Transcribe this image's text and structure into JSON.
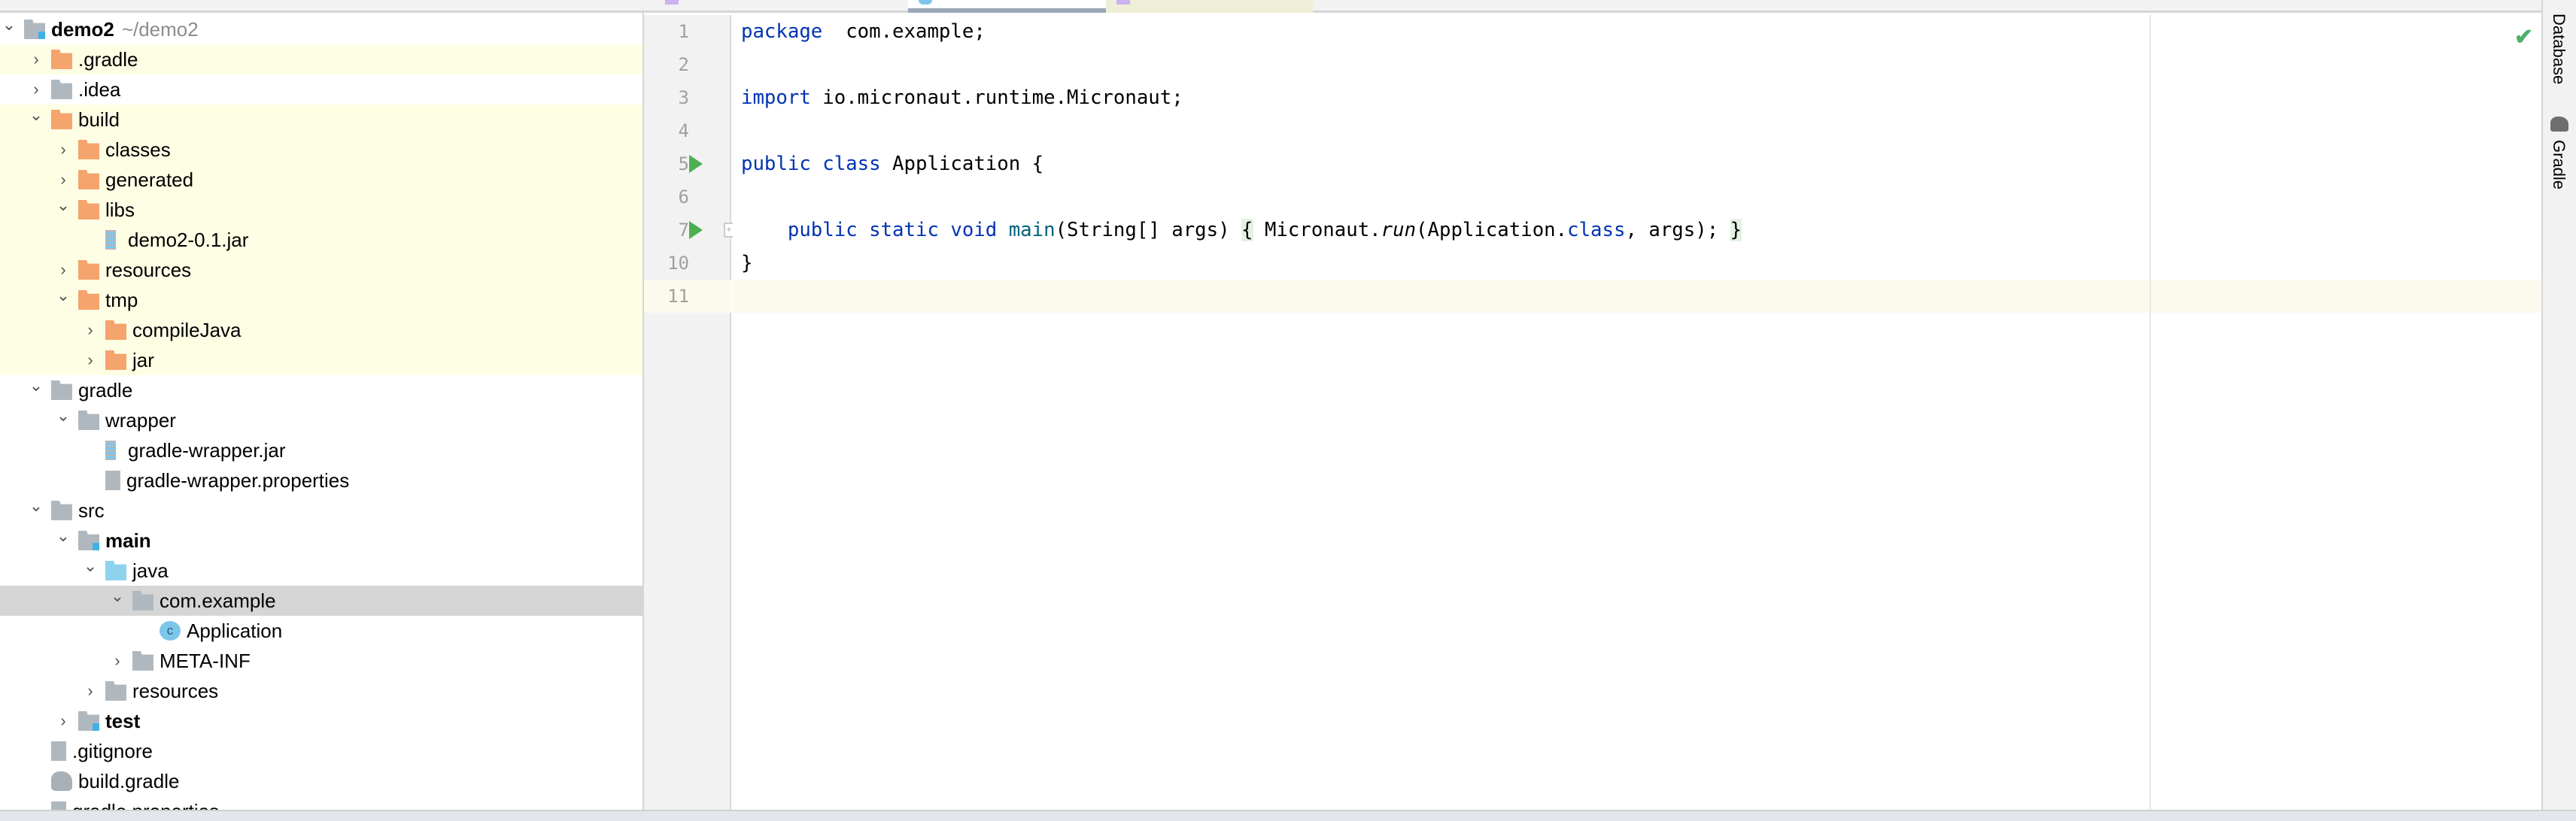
{
  "tree": {
    "rows": [
      {
        "label": "demo2",
        "hint": "~/demo2",
        "level": 0,
        "chev": "down",
        "icon": "module-folder-icon",
        "bold": true
      },
      {
        "label": ".gradle",
        "level": 1,
        "chev": "right",
        "icon": "excluded-folder-icon",
        "yellow": true
      },
      {
        "label": ".idea",
        "level": 1,
        "chev": "right",
        "icon": "folder-icon"
      },
      {
        "label": "build",
        "level": 1,
        "chev": "down",
        "icon": "excluded-folder-icon",
        "yellow": true
      },
      {
        "label": "classes",
        "level": 2,
        "chev": "right",
        "icon": "excluded-folder-icon",
        "yellow": true
      },
      {
        "label": "generated",
        "level": 2,
        "chev": "right",
        "icon": "excluded-folder-icon",
        "yellow": true
      },
      {
        "label": "libs",
        "level": 2,
        "chev": "down",
        "icon": "excluded-folder-icon",
        "yellow": true
      },
      {
        "label": "demo2-0.1.jar",
        "level": 3,
        "chev": "",
        "icon": "jar-icon",
        "yellow": true
      },
      {
        "label": "resources",
        "level": 2,
        "chev": "right",
        "icon": "excluded-folder-icon",
        "yellow": true
      },
      {
        "label": "tmp",
        "level": 2,
        "chev": "down",
        "icon": "excluded-folder-icon",
        "yellow": true
      },
      {
        "label": "compileJava",
        "level": 3,
        "chev": "right",
        "icon": "excluded-folder-icon",
        "yellow": true
      },
      {
        "label": "jar",
        "level": 3,
        "chev": "right",
        "icon": "excluded-folder-icon",
        "yellow": true
      },
      {
        "label": "gradle",
        "level": 1,
        "chev": "down",
        "icon": "folder-icon"
      },
      {
        "label": "wrapper",
        "level": 2,
        "chev": "down",
        "icon": "folder-icon"
      },
      {
        "label": "gradle-wrapper.jar",
        "level": 3,
        "chev": "",
        "icon": "jar-icon"
      },
      {
        "label": "gradle-wrapper.properties",
        "level": 3,
        "chev": "",
        "icon": "properties-icon"
      },
      {
        "label": "src",
        "level": 1,
        "chev": "down",
        "icon": "folder-icon"
      },
      {
        "label": "main",
        "level": 2,
        "chev": "down",
        "icon": "module-folder-icon",
        "bold": true
      },
      {
        "label": "java",
        "level": 3,
        "chev": "down",
        "icon": "source-folder-icon"
      },
      {
        "label": "com.example",
        "level": 4,
        "chev": "down",
        "icon": "package-icon",
        "selected": true
      },
      {
        "label": "Application",
        "level": 5,
        "chev": "",
        "icon": "java-class-icon"
      },
      {
        "label": "META-INF",
        "level": 4,
        "chev": "right",
        "icon": "folder-icon"
      },
      {
        "label": "resources",
        "level": 3,
        "chev": "right",
        "icon": "resources-folder-icon"
      },
      {
        "label": "test",
        "level": 2,
        "chev": "right",
        "icon": "module-folder-icon",
        "bold": true
      },
      {
        "label": ".gitignore",
        "level": 1,
        "chev": "",
        "icon": "ignore-file-icon"
      },
      {
        "label": "build.gradle",
        "level": 1,
        "chev": "",
        "icon": "gradle-file-icon"
      },
      {
        "label": "gradle.properties",
        "level": 1,
        "chev": "",
        "icon": "properties-icon"
      }
    ]
  },
  "editor": {
    "lines": [
      {
        "num": "1",
        "tokens": [
          [
            "kw",
            "package"
          ],
          [
            "",
            "  com.example;"
          ]
        ]
      },
      {
        "num": "2",
        "tokens": []
      },
      {
        "num": "3",
        "tokens": [
          [
            "kw",
            "import"
          ],
          [
            "",
            " io.micronaut.runtime.Micronaut;"
          ]
        ]
      },
      {
        "num": "4",
        "tokens": []
      },
      {
        "num": "5",
        "run": true,
        "tokens": [
          [
            "kw",
            "public class"
          ],
          [
            "",
            " Application {"
          ]
        ]
      },
      {
        "num": "6",
        "tokens": []
      },
      {
        "num": "7",
        "run": true,
        "fold": true,
        "tokens": [
          [
            "",
            "    "
          ],
          [
            "kw",
            "public static void"
          ],
          [
            "",
            " "
          ],
          [
            "fn",
            "main"
          ],
          [
            "",
            "(String[] args) "
          ],
          [
            "brace",
            "{"
          ],
          [
            "",
            " Micronaut."
          ],
          [
            "it",
            "run"
          ],
          [
            "",
            "(Application."
          ],
          [
            "kw",
            "class"
          ],
          [
            "",
            ", args); "
          ],
          [
            "brace",
            "}"
          ]
        ]
      },
      {
        "num": "10",
        "tokens": [
          [
            "",
            "}"
          ]
        ]
      },
      {
        "num": "11",
        "current": true,
        "tokens": []
      }
    ],
    "status_icon": "check-icon"
  },
  "right_toolbar": {
    "database": "Database",
    "gradle": "Gradle"
  },
  "colors": {
    "keyword": "#0033b3",
    "excluded_bg": "#fefee5",
    "selected_bg": "#d5d5d5",
    "run": "#4caf50"
  }
}
